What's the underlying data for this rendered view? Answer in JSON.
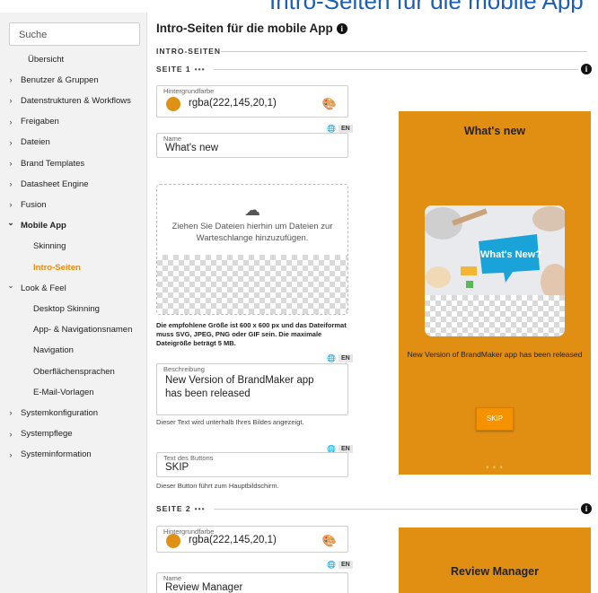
{
  "banner": {
    "text": "Intro-Seiten für die mobile App"
  },
  "colors": {
    "accent": "#e38d14",
    "preview_bg": "#e18f13",
    "swatch": "#de9114",
    "button": "#f59200"
  },
  "sidebar": {
    "search_placeholder": "Suche",
    "items": [
      {
        "label": "Übersicht",
        "icon": "",
        "type": "plain"
      },
      {
        "label": "Benutzer & Gruppen",
        "icon": "chevron-right-icon",
        "type": "group"
      },
      {
        "label": "Datenstrukturen & Workflows",
        "icon": "chevron-right-icon",
        "type": "group"
      },
      {
        "label": "Freigaben",
        "icon": "chevron-right-icon",
        "type": "group"
      },
      {
        "label": "Dateien",
        "icon": "chevron-right-icon",
        "type": "group"
      },
      {
        "label": "Brand Templates",
        "icon": "chevron-right-icon",
        "type": "group"
      },
      {
        "label": "Datasheet Engine",
        "icon": "chevron-right-icon",
        "type": "group"
      },
      {
        "label": "Fusion",
        "icon": "chevron-right-icon",
        "type": "group"
      },
      {
        "label": "Mobile App",
        "icon": "chevron-down-icon",
        "type": "group-open"
      },
      {
        "label": "Skinning",
        "icon": "",
        "type": "sub"
      },
      {
        "label": "Intro-Seiten",
        "icon": "",
        "type": "sub-active"
      },
      {
        "label": "Look & Feel",
        "icon": "chevron-down-icon",
        "type": "group"
      },
      {
        "label": "Desktop Skinning",
        "icon": "",
        "type": "sub"
      },
      {
        "label": "App- & Navigationsnamen",
        "icon": "",
        "type": "sub"
      },
      {
        "label": "Navigation",
        "icon": "",
        "type": "sub"
      },
      {
        "label": "Oberflächensprachen",
        "icon": "",
        "type": "sub"
      },
      {
        "label": "E-Mail-Vorlagen",
        "icon": "",
        "type": "sub"
      },
      {
        "label": "Systemkonfiguration",
        "icon": "chevron-right-icon",
        "type": "group"
      },
      {
        "label": "Systempflege",
        "icon": "chevron-right-icon",
        "type": "group"
      },
      {
        "label": "Systeminformation",
        "icon": "chevron-right-icon",
        "type": "group"
      }
    ]
  },
  "main": {
    "title": "Intro-Seiten für die mobile App",
    "info_icon": "i",
    "section_label": "INTRO-SEITEN",
    "more_dots": "•••",
    "lang_badge": "EN",
    "page1": {
      "label": "SEITE 1",
      "bg_label": "Hintergrundfarbe",
      "bg_value": "rgba(222,145,20,1)",
      "name_label": "Name",
      "name_value": "What's new",
      "dropzone_text": "Ziehen Sie Dateien hierhin um Dateien zur Warteschlange hinzuzufügen.",
      "size_hint": "Die empfohlene Größe ist 600 x 600 px und das Dateiformat muss SVG, JPEG, PNG oder GIF sein. Die maximale Dateigröße beträgt 5 MB.",
      "desc_label": "Beschreibung",
      "desc_value": "New Version of BrandMaker app has been released",
      "desc_hint": "Dieser Text wird unterhalb Ihres Bildes angezeigt.",
      "button_label": "Text des Buttons",
      "button_value": "SKIP",
      "button_hint": "Dieser Button führt zum Hauptbildschirm."
    },
    "page2": {
      "label": "SEITE 2",
      "bg_label": "Hintergrundfarbe",
      "bg_value": "rgba(222,145,20,1)",
      "name_label": "Name",
      "name_value": "Review Manager"
    }
  },
  "preview1": {
    "title": "What's new",
    "bubble": "What's New?",
    "description": "New Version of BrandMaker app has been released",
    "button": "SKIP",
    "pager": "• • •"
  },
  "preview2": {
    "title": "Review Manager"
  }
}
